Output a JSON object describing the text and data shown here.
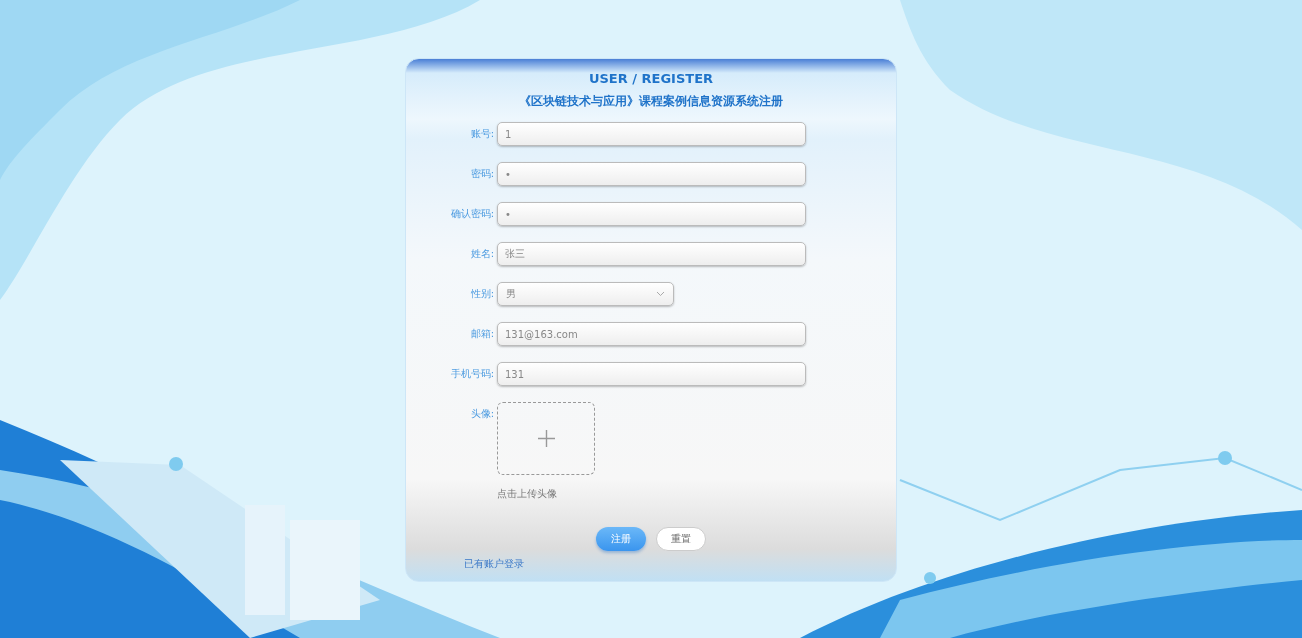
{
  "form": {
    "title": "USER / REGISTER",
    "subtitle": "《区块链技术与应用》课程案例信息资源系统注册",
    "fields": [
      {
        "kind": "text",
        "label": "账号:",
        "value": "1"
      },
      {
        "kind": "text",
        "label": "密码:",
        "value": "•"
      },
      {
        "kind": "text",
        "label": "确认密码:",
        "value": "•"
      },
      {
        "kind": "text",
        "label": "姓名:",
        "value": "张三"
      },
      {
        "kind": "select",
        "label": "性别:",
        "value": "男"
      },
      {
        "kind": "text",
        "label": "邮箱:",
        "value": "131@163.com"
      },
      {
        "kind": "text",
        "label": "手机号码:",
        "value": "131"
      },
      {
        "kind": "upload",
        "label": "头像:",
        "hint": "点击上传头像"
      }
    ],
    "buttons": [
      {
        "label": "注册",
        "kind": "primary"
      },
      {
        "label": "重置",
        "kind": "default"
      }
    ],
    "login_link": "已有账户登录"
  }
}
